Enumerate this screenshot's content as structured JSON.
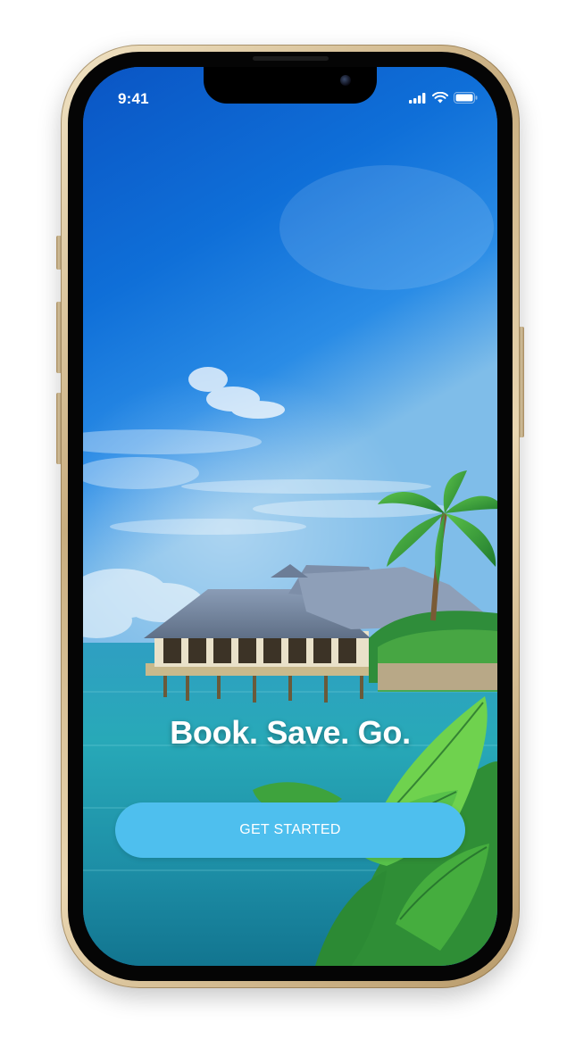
{
  "status_bar": {
    "time": "9:41",
    "icons": [
      "cellular-signal-icon",
      "wifi-icon",
      "battery-icon"
    ]
  },
  "onboarding": {
    "headline": "Book. Save. Go.",
    "cta_label": "GET STARTED"
  },
  "colors": {
    "cta_background": "#4ebfee",
    "text": "#ffffff",
    "phone_frame": "#d4bc8f"
  }
}
